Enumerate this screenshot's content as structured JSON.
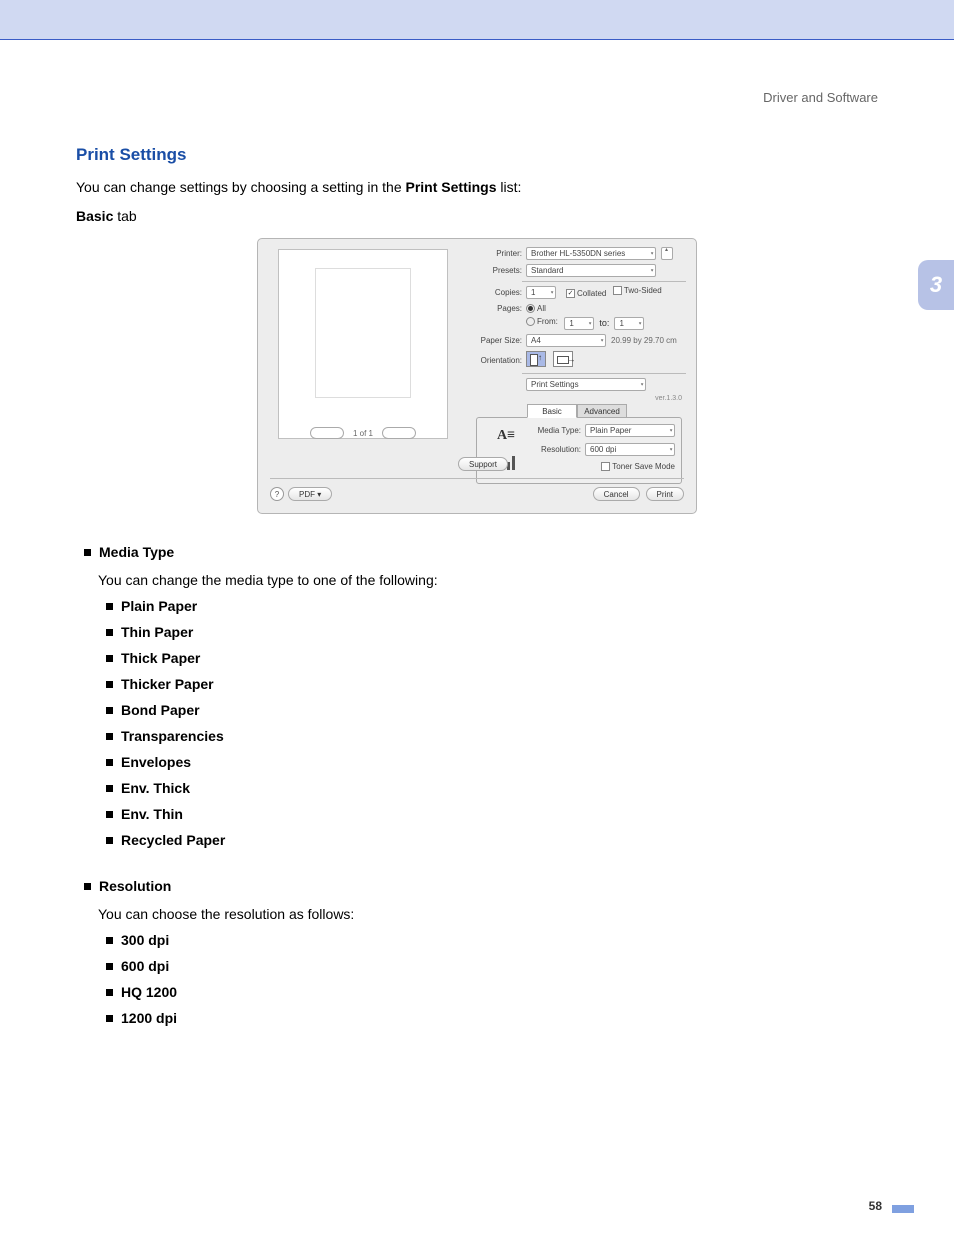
{
  "header": {
    "breadcrumb": "Driver and Software"
  },
  "chapter_tab": "3",
  "section": {
    "title": "Print Settings",
    "lead_before": "You can change settings by choosing a setting in the ",
    "lead_bold": "Print Settings",
    "lead_after": " list:",
    "subhead_bold": "Basic",
    "subhead_after": " tab"
  },
  "dialog": {
    "pager": "1 of 1",
    "printer_label": "Printer:",
    "printer_value": "Brother HL-5350DN series",
    "presets_label": "Presets:",
    "presets_value": "Standard",
    "copies_label": "Copies:",
    "copies_value": "1",
    "collated_label": "Collated",
    "twosided_label": "Two-Sided",
    "pages_label": "Pages:",
    "pages_all": "All",
    "pages_from": "From:",
    "pages_from_value": "1",
    "pages_to": "to:",
    "pages_to_value": "1",
    "papersize_label": "Paper Size:",
    "papersize_value": "A4",
    "papersize_dim": "20.99 by 29.70 cm",
    "orientation_label": "Orientation:",
    "printsettings_value": "Print Settings",
    "version": "ver.1.3.0",
    "tab_basic": "Basic",
    "tab_advanced": "Advanced",
    "mediatype_label": "Media Type:",
    "mediatype_value": "Plain Paper",
    "resolution_label": "Resolution:",
    "resolution_value": "600 dpi",
    "tonersave_label": "Toner Save Mode",
    "support_btn": "Support",
    "pdf_btn": "PDF ▾",
    "cancel_btn": "Cancel",
    "print_btn": "Print"
  },
  "media_type": {
    "heading": "Media Type",
    "intro": "You can change the media type to one of the following:",
    "items": [
      "Plain Paper",
      "Thin Paper",
      "Thick Paper",
      "Thicker Paper",
      "Bond Paper",
      "Transparencies",
      "Envelopes",
      "Env. Thick",
      "Env. Thin",
      "Recycled Paper"
    ]
  },
  "resolution": {
    "heading": "Resolution",
    "intro": "You can choose the resolution as follows:",
    "items": [
      "300 dpi",
      "600 dpi",
      "HQ 1200",
      "1200 dpi"
    ]
  },
  "page_number": "58"
}
